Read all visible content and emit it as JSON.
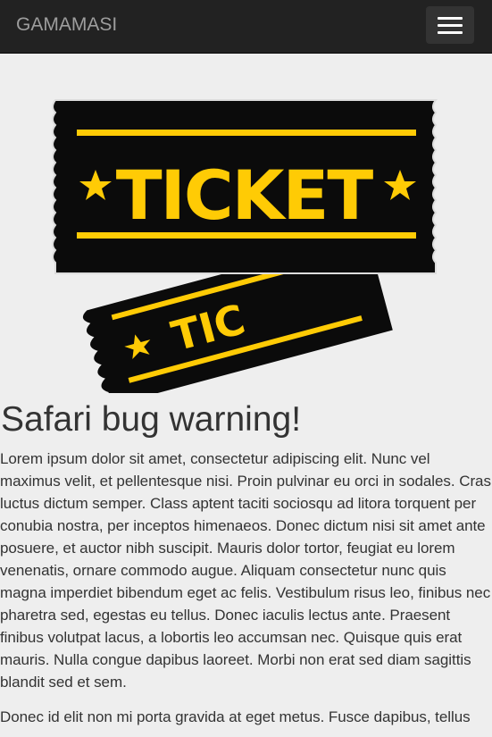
{
  "navbar": {
    "brand": "GAMAMASI",
    "toggle_icon": "hamburger-menu-icon"
  },
  "hero": {
    "image_icon": "ticket-icon",
    "ticket_text": "TICKET",
    "colors": {
      "ticket_black": "#0b0b0b",
      "ticket_yellow": "#ffcb05"
    }
  },
  "article": {
    "title": "Safari bug warning!",
    "paragraphs": [
      "Lorem ipsum dolor sit amet, consectetur adipiscing elit. Nunc vel maximus velit, et pellentesque nisi. Proin pulvinar eu orci in sodales. Cras luctus dictum semper. Class aptent taciti sociosqu ad litora torquent per conubia nostra, per inceptos himenaeos. Donec dictum nisi sit amet ante posuere, et auctor nibh suscipit. Mauris dolor tortor, feugiat eu lorem venenatis, ornare commodo augue. Aliquam consectetur nunc quis magna imperdiet bibendum eget ac felis. Vestibulum risus leo, finibus nec pharetra sed, egestas eu tellus. Donec iaculis lectus ante. Praesent finibus volutpat lacus, a lobortis leo accumsan nec. Quisque quis erat mauris. Nulla congue dapibus laoreet. Morbi non erat sed diam sagittis blandit sed et sem.",
      "Donec id elit non mi porta gravida at eget metus. Fusce dapibus, tellus"
    ]
  }
}
